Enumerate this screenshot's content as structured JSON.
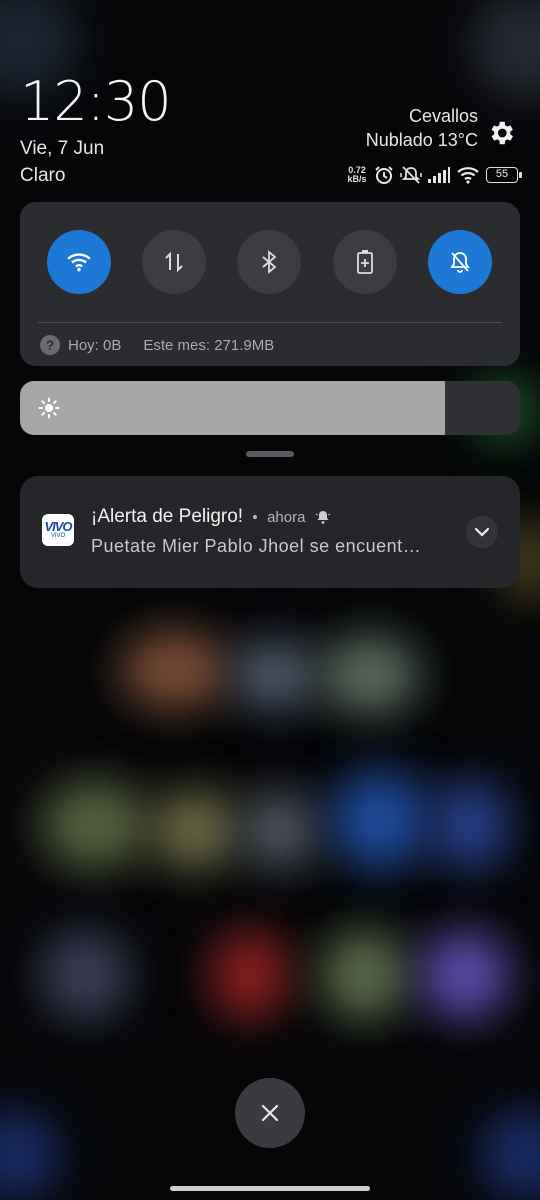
{
  "status": {
    "time": "12:30",
    "date": "Vie, 7 Jun",
    "carrier": "Claro",
    "city": "Cevallos",
    "weather": "Nublado 13°C",
    "speed_value": "0.72",
    "speed_unit": "kB/s",
    "battery": "55",
    "icons": [
      "alarm-icon",
      "silent-vibrate-icon",
      "signal-icon",
      "wifi-icon",
      "battery-icon"
    ]
  },
  "quick_settings": {
    "tiles": [
      {
        "name": "wifi",
        "icon": "wifi-icon",
        "active": true
      },
      {
        "name": "mobile-data",
        "icon": "data-arrows-icon",
        "active": false
      },
      {
        "name": "bluetooth",
        "icon": "bluetooth-icon",
        "active": false
      },
      {
        "name": "battery-saver",
        "icon": "battery-plus-icon",
        "active": false
      },
      {
        "name": "mute",
        "icon": "bell-off-icon",
        "active": true
      }
    ],
    "data_today": "Hoy: 0B",
    "data_month": "Este mes: 271.9MB"
  },
  "brightness": {
    "level": 0.85
  },
  "notification": {
    "app_icon_text": "VIVO",
    "app_icon_sub": "VIVO",
    "title": "¡Alerta de Peligro!",
    "time": "ahora",
    "body": "Puetate Mier Pablo Jhoel se encuent…"
  },
  "colors": {
    "accent": "#1e78d6",
    "panel": "#2c2e32",
    "background": "#050608"
  }
}
